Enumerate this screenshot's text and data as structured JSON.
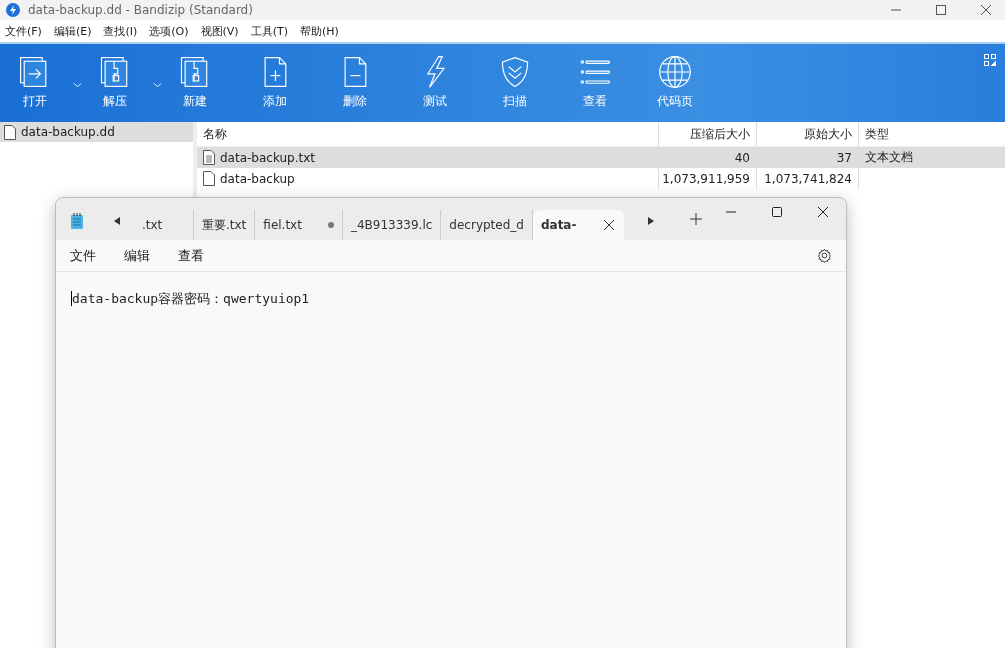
{
  "window": {
    "title": "data-backup.dd - Bandizip (Standard)"
  },
  "menu": [
    "文件(F)",
    "编辑(E)",
    "查找(I)",
    "选项(O)",
    "视图(V)",
    "工具(T)",
    "帮助(H)"
  ],
  "toolbar": [
    {
      "label": "打开",
      "dropdown": true
    },
    {
      "label": "解压",
      "dropdown": true
    },
    {
      "label": "新建",
      "dropdown": false
    },
    {
      "label": "添加",
      "dropdown": false
    },
    {
      "label": "删除",
      "dropdown": false
    },
    {
      "label": "测试",
      "dropdown": false
    },
    {
      "label": "扫描",
      "dropdown": false
    },
    {
      "label": "查看",
      "dropdown": false
    },
    {
      "label": "代码页",
      "dropdown": false
    }
  ],
  "sidebar": {
    "items": [
      {
        "label": "data-backup.dd",
        "selected": true
      }
    ]
  },
  "table": {
    "columns": [
      "名称",
      "压缩后大小",
      "原始大小",
      "类型"
    ],
    "rows": [
      {
        "name": "data-backup.txt",
        "compressed": "40",
        "original": "37",
        "type": "文本文档",
        "selected": true
      },
      {
        "name": "data-backup",
        "compressed": "1,073,911,959",
        "original": "1,073,741,824",
        "type": "",
        "selected": false
      }
    ]
  },
  "notepad": {
    "tabs": [
      {
        "label": ".txt",
        "selected": false,
        "modified": false
      },
      {
        "label": "重要.txt",
        "selected": false,
        "modified": false
      },
      {
        "label": "fiel.txt",
        "selected": false,
        "modified": true
      },
      {
        "label": "_4B913339.lc",
        "selected": false,
        "modified": false
      },
      {
        "label": "decrypted_d",
        "selected": false,
        "modified": false
      },
      {
        "label": "data-",
        "selected": true,
        "modified": false
      }
    ],
    "menu": [
      "文件",
      "编辑",
      "查看"
    ],
    "content": "data-backup容器密码：qwertyuiop1"
  }
}
